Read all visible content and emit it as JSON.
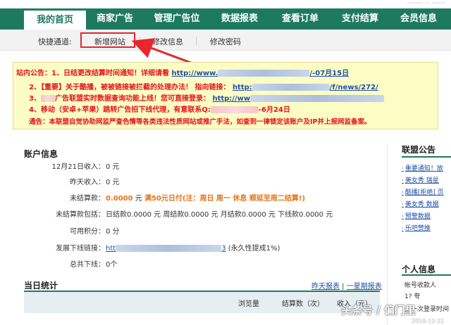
{
  "nav": {
    "items": [
      "我的首页",
      "商家广告",
      "管理广告位",
      "数据报表",
      "查看订单",
      "支付结算",
      "会员信息"
    ],
    "active_index": 0
  },
  "subnav": {
    "label": "快捷通道:",
    "links": [
      "新增网站",
      "修改信息",
      "修改密码"
    ],
    "highlighted": "新增网站"
  },
  "notice": {
    "line1_prefix": "站内公告：",
    "line1_text": "1、日结更改结算时间通知！详细请看",
    "line1_link": "http://www.",
    "line1_suffix": "/-07月15日",
    "line2_text": "2、【重要】关于酷播，被被链接被拦截的处理办法！ 指向链接：",
    "line2_link": "http:",
    "line2_suffix": "/f/news/272/",
    "line3_text": "广告联盟实时数据查询功能上线！您可直接登录：",
    "line3_num": "3、",
    "line3_link": "http://ww",
    "line4_text": "4、移动（安卓+苹果）跳转广告招下线代理，有意联系Q:",
    "line4_suffix": "-6月24日",
    "line5_text": "通告：本联盟自觉协助网监严查色情等各类违法性质网站或推广手法，如查到一律锁定该账户及IP并上报网监备案。"
  },
  "account": {
    "title": "账户信息",
    "rows": [
      {
        "key": "12月21日收入：",
        "value": "0 元"
      },
      {
        "key": "昨天收入：",
        "value": "0 元"
      },
      {
        "key": "未结算款：",
        "value_num": "0.0000",
        "value_unit": "元",
        "value_note": "满50元日付(注：周日 周一 休息 顺延至周二结算!)"
      },
      {
        "key": "未结算款包括：",
        "value": "日结款0.0000 元 周结款0.0000 元 月结款0.0000 元 下线款0.0000 元"
      },
      {
        "key": "可用积分：",
        "value": "0 分"
      },
      {
        "key": "发展下线链接：",
        "link": "htt",
        "link_suffix": "3",
        "value_note": "(永久性提成1%)"
      },
      {
        "key": "总共下线：",
        "value": "0个"
      }
    ]
  },
  "stats": {
    "title": "当日统计",
    "links": [
      "昨天报表",
      "一星期报表"
    ],
    "columns": [
      "浏览量",
      "结算数（次）",
      "收入（元）"
    ]
  },
  "sidebar": {
    "title": "联盟公告",
    "items": [
      "重要通知！放",
      "美女秀 瑞星 ",
      "酷播[拒绝] 页",
      "美女秀 数据 ",
      "预警数据 ",
      "乐吧赞推 "
    ]
  },
  "personal": {
    "title": "个人信息",
    "rows": [
      "帐号收款人",
      "1? 夸",
      "上一次登录时间"
    ]
  },
  "watermark": {
    "text": "头条号 / 偏门里",
    "date": "2016-12-21"
  },
  "colors": {
    "nav_bg": "#1d7a5f",
    "highlight": "#e8262b",
    "notice_bg": "#fbfdc5",
    "link": "#1f4fa8"
  }
}
